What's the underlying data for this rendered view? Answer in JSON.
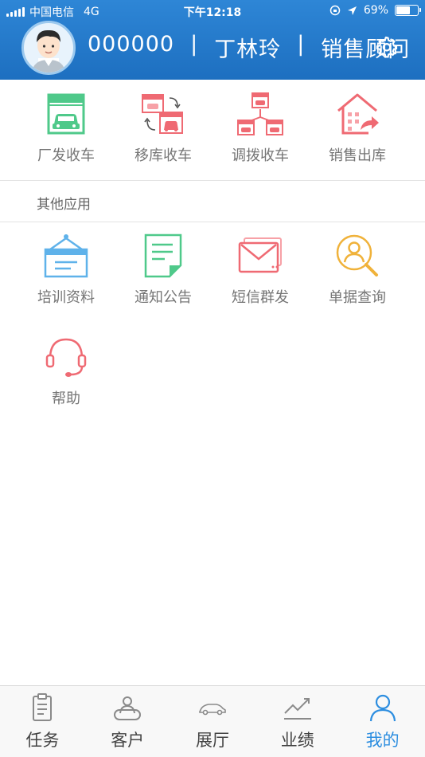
{
  "status_bar": {
    "carrier": "中国电信",
    "network": "4G",
    "time": "下午12:18",
    "battery_percent": "69%",
    "battery_level": 0.69
  },
  "header": {
    "user_id": "000000",
    "separator": "|",
    "user_name": "丁林玲",
    "role": "销售顾问",
    "colors": {
      "bar_top": "#2e86d6",
      "bar_bottom": "#1d6fc0"
    }
  },
  "main_apps": [
    {
      "label": "厂发收车",
      "icon": "factory-car-icon",
      "color": "#4fc98a"
    },
    {
      "label": "移库收车",
      "icon": "transfer-warehouse-icon",
      "color": "#ef6a73"
    },
    {
      "label": "调拨收车",
      "icon": "allocation-icon",
      "color": "#ef6a73"
    },
    {
      "label": "销售出库",
      "icon": "sales-outbound-icon",
      "color": "#ef6a73"
    }
  ],
  "other_section": {
    "title": "其他应用",
    "apps": [
      {
        "label": "培训资料",
        "icon": "training-board-icon",
        "color": "#5fb2ea"
      },
      {
        "label": "通知公告",
        "icon": "notice-document-icon",
        "color": "#4fc98a"
      },
      {
        "label": "短信群发",
        "icon": "sms-envelope-icon",
        "color": "#ef6a73"
      },
      {
        "label": "单据查询",
        "icon": "search-person-icon",
        "color": "#f0b23a"
      },
      {
        "label": "帮助",
        "icon": "headset-icon",
        "color": "#ef6a73"
      }
    ]
  },
  "tabbar": {
    "active_color": "#2d8ee0",
    "tabs": [
      {
        "label": "任务",
        "icon": "clipboard-icon",
        "active": false
      },
      {
        "label": "客户",
        "icon": "customers-icon",
        "active": false
      },
      {
        "label": "展厅",
        "icon": "car-icon",
        "active": false
      },
      {
        "label": "业绩",
        "icon": "trend-chart-icon",
        "active": false
      },
      {
        "label": "我的",
        "icon": "user-icon",
        "active": true
      }
    ]
  }
}
